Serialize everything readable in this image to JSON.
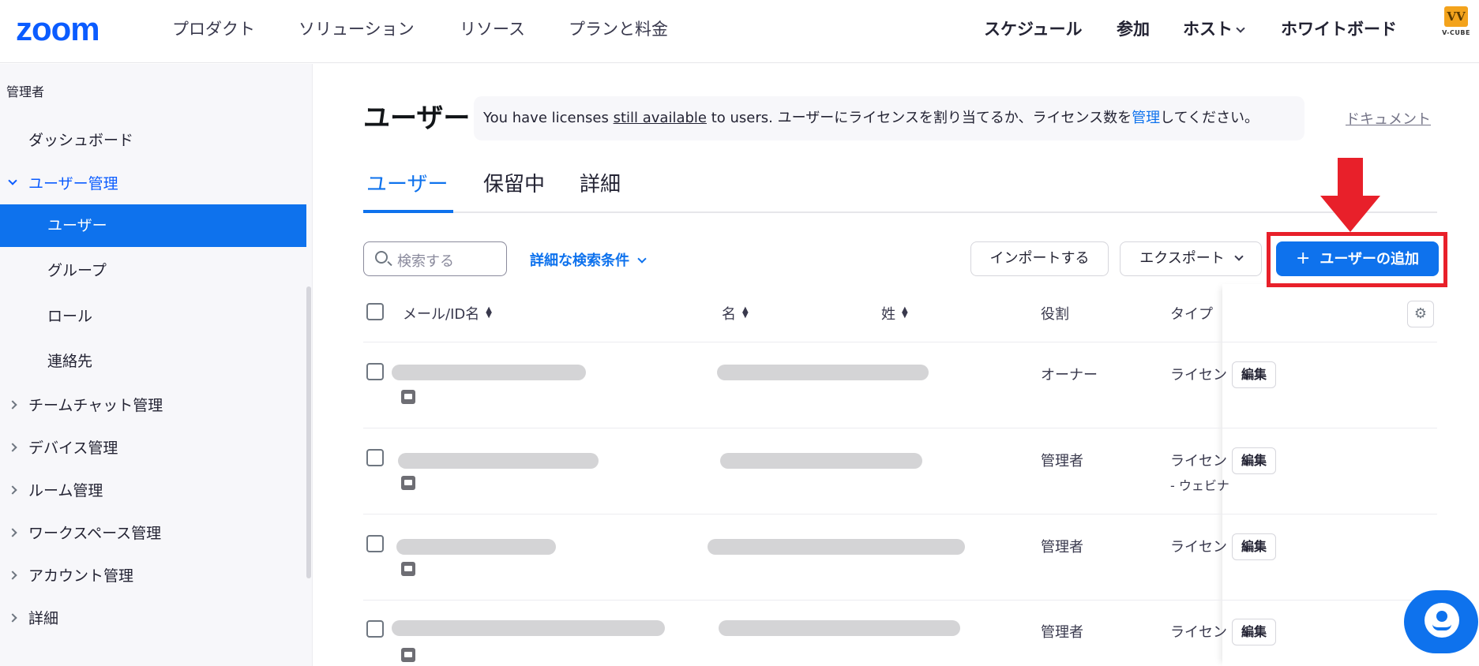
{
  "topnav": {
    "logo": "zoom",
    "left_items": [
      "プロダクト",
      "ソリューション",
      "リソース",
      "プランと料金"
    ],
    "right_items": [
      "スケジュール",
      "参加",
      "ホスト",
      "ホワイトボード"
    ],
    "brand_badge_text": "V-CUBE",
    "brand_badge_mark": "VV"
  },
  "sidebar": {
    "section_label": "管理者",
    "items": [
      {
        "label": "ダッシュボード"
      },
      {
        "label": "ユーザー管理"
      },
      {
        "label": "ユーザー"
      },
      {
        "label": "グループ"
      },
      {
        "label": "ロール"
      },
      {
        "label": "連絡先"
      },
      {
        "label": "チームチャット管理"
      },
      {
        "label": "デバイス管理"
      },
      {
        "label": "ルーム管理"
      },
      {
        "label": "ワークスペース管理"
      },
      {
        "label": "アカウント管理"
      },
      {
        "label": "詳細"
      }
    ]
  },
  "main": {
    "title": "ユーザー",
    "banner": {
      "part1": "You have licenses ",
      "link1": "still available",
      "part2": " to users. ユーザーにライセンスを割り当てるか、ライセンス数を",
      "link2": "管理",
      "part3": "してください。"
    },
    "doc_link": "ドキュメント",
    "tabs": [
      "ユーザー",
      "保留中",
      "詳細"
    ],
    "search_placeholder": "検索する",
    "advanced_search": "詳細な検索条件",
    "import_button": "インポートする",
    "export_button": "エクスポート",
    "add_user_button": "ユーザーの追加",
    "add_user_plus": "+",
    "table": {
      "headers": [
        "メール/ID名",
        "名",
        "姓",
        "役割",
        "タイプ"
      ],
      "rows": [
        {
          "role": "オーナー",
          "type": "ライセン",
          "type_sub": "",
          "edit": "編集"
        },
        {
          "role": "管理者",
          "type": "ライセン",
          "type_sub": "- ウェビナ",
          "edit": "編集"
        },
        {
          "role": "管理者",
          "type": "ライセン",
          "type_sub": "",
          "edit": "編集"
        },
        {
          "role": "管理者",
          "type": "ライセン",
          "type_sub": "",
          "edit": "編集"
        }
      ]
    }
  },
  "colors": {
    "accent": "#0e72ed",
    "brand": "#0b5cff",
    "highlight": "#e8202a"
  },
  "icons": [
    "search-icon",
    "chevron-down-icon",
    "sort-icon",
    "gear-icon",
    "mail-icon",
    "plus-icon",
    "chat-icon",
    "arrow-down-icon"
  ]
}
